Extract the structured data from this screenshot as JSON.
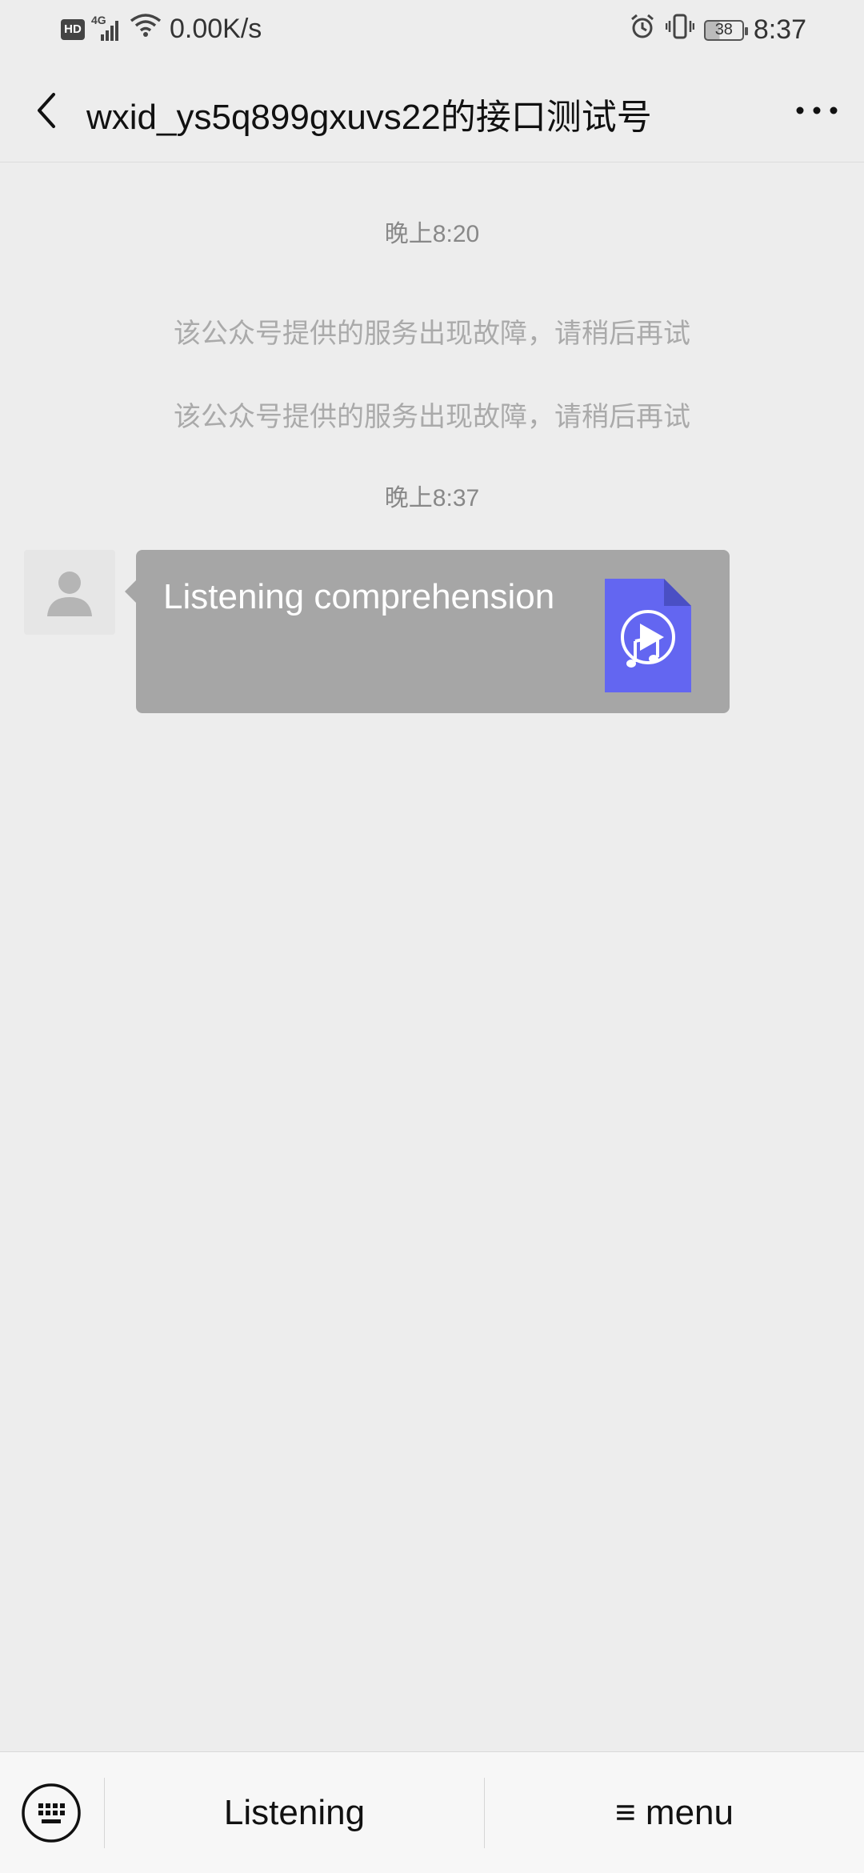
{
  "status_bar": {
    "hd": "HD",
    "network": "4G",
    "speed": "0.00K/s",
    "battery": "38",
    "time": "8:37",
    "icons": [
      "hd-icon",
      "signal-icon",
      "wifi-icon",
      "alarm-icon",
      "vibrate-icon",
      "battery-icon"
    ]
  },
  "header": {
    "title": "wxid_ys5q899gxuvs22的接口测试号",
    "back_icon": "chevron-left-icon",
    "more_icon": "more-dots-icon"
  },
  "chat": {
    "timestamp_1": "晚上8:20",
    "system_messages": [
      "该公众号提供的服务出现故障，请稍后再试",
      "该公众号提供的服务出现故障，请稍后再试"
    ],
    "timestamp_2": "晚上8:37",
    "message": {
      "text": "Listening comprehension",
      "file_icon": "audio-file-icon",
      "file_color": "#6366f1"
    }
  },
  "bottom_bar": {
    "keyboard_icon": "keyboard-icon",
    "menu_1": "Listening",
    "menu_2": "≡ menu"
  }
}
